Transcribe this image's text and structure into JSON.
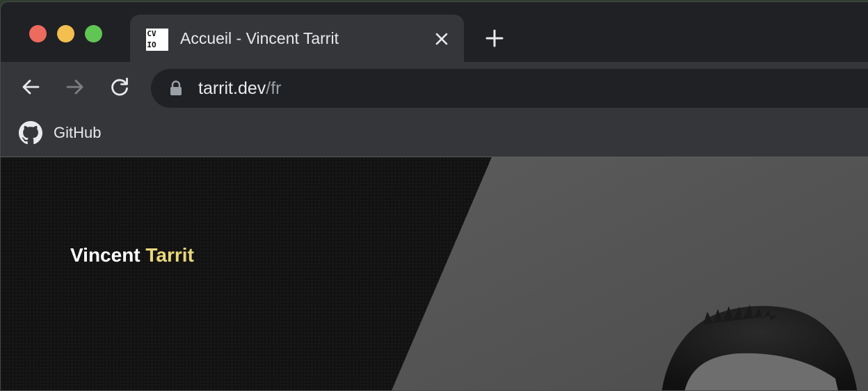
{
  "browser": {
    "tab": {
      "favicon_text": [
        "CV",
        "IO"
      ],
      "title": "Accueil - Vincent Tarrit",
      "close_icon": "close-icon"
    },
    "new_tab_icon": "plus-icon",
    "nav": {
      "back_icon": "arrow-left-icon",
      "forward_icon": "arrow-right-icon",
      "reload_icon": "reload-icon"
    },
    "address_bar": {
      "lock_icon": "lock-icon",
      "host": "tarrit.dev",
      "path": "/fr"
    },
    "bookmarks": [
      {
        "icon": "github-icon",
        "label": "GitHub"
      }
    ]
  },
  "page": {
    "site_name_first": "Vincent",
    "site_name_last": "Tarrit",
    "accent_color": "#e9d77a",
    "background_color": "#121212"
  }
}
